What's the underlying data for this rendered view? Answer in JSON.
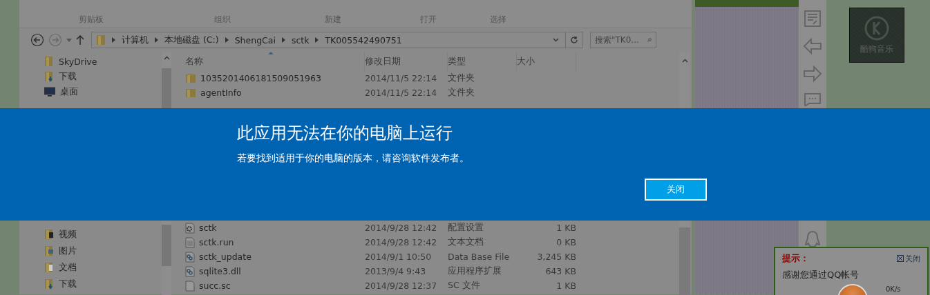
{
  "ribbon": {
    "groups": [
      "剪贴板",
      "组织",
      "新建",
      "打开",
      "选择"
    ]
  },
  "address_bar": {
    "path": [
      "计算机",
      "本地磁盘 (C:)",
      "ShengCai",
      "sctk",
      "TK005542490751"
    ],
    "search_placeholder": "搜索\"TK0..."
  },
  "nav_top": [
    {
      "label": "SkyDrive",
      "kind": "folder"
    },
    {
      "label": "下载",
      "kind": "download"
    },
    {
      "label": "桌面",
      "kind": "desktop"
    }
  ],
  "nav_bottom": [
    {
      "label": "视频",
      "kind": "video"
    },
    {
      "label": "图片",
      "kind": "picture"
    },
    {
      "label": "文档",
      "kind": "document"
    },
    {
      "label": "下载",
      "kind": "download"
    }
  ],
  "columns": [
    "名称",
    "修改日期",
    "类型",
    "大小"
  ],
  "rows_top": [
    {
      "name": "1035201406181509051963",
      "date": "2014/11/5 22:14",
      "type": "文件夹",
      "kind": "folder"
    },
    {
      "name": "agentInfo",
      "date": "2014/11/5 22:14",
      "type": "文件夹",
      "kind": "folder"
    }
  ],
  "rows_bottom": [
    {
      "name": "sctk",
      "date": "2014/9/28 12:42",
      "type": "配置设置",
      "size": "1 KB",
      "kind": "config"
    },
    {
      "name": "sctk.run",
      "date": "2014/9/28 12:42",
      "type": "文本文档",
      "size": "0 KB",
      "kind": "text"
    },
    {
      "name": "sctk_update",
      "date": "2014/9/1 10:50",
      "type": "Data Base File",
      "size": "3,245 KB",
      "kind": "library"
    },
    {
      "name": "sqlite3.dll",
      "date": "2013/9/4 9:43",
      "type": "应用程序扩展",
      "size": "643 KB",
      "kind": "library"
    },
    {
      "name": "succ.sc",
      "date": "2014/9/28 12:37",
      "type": "SC 文件",
      "size": "1 KB",
      "kind": "blank"
    }
  ],
  "dialog": {
    "title": "此应用无法在你的电脑上运行",
    "message": "若要找到适用于你的电脑的版本，请咨询软件发布者。",
    "button": "关闭"
  },
  "kugou_tile": {
    "label": "酷狗音乐"
  },
  "notice": {
    "title": "提示：",
    "close": "关闭",
    "message": "感谢您通过QQ帐号"
  },
  "speed_ball": {
    "speed": "0K/s"
  }
}
